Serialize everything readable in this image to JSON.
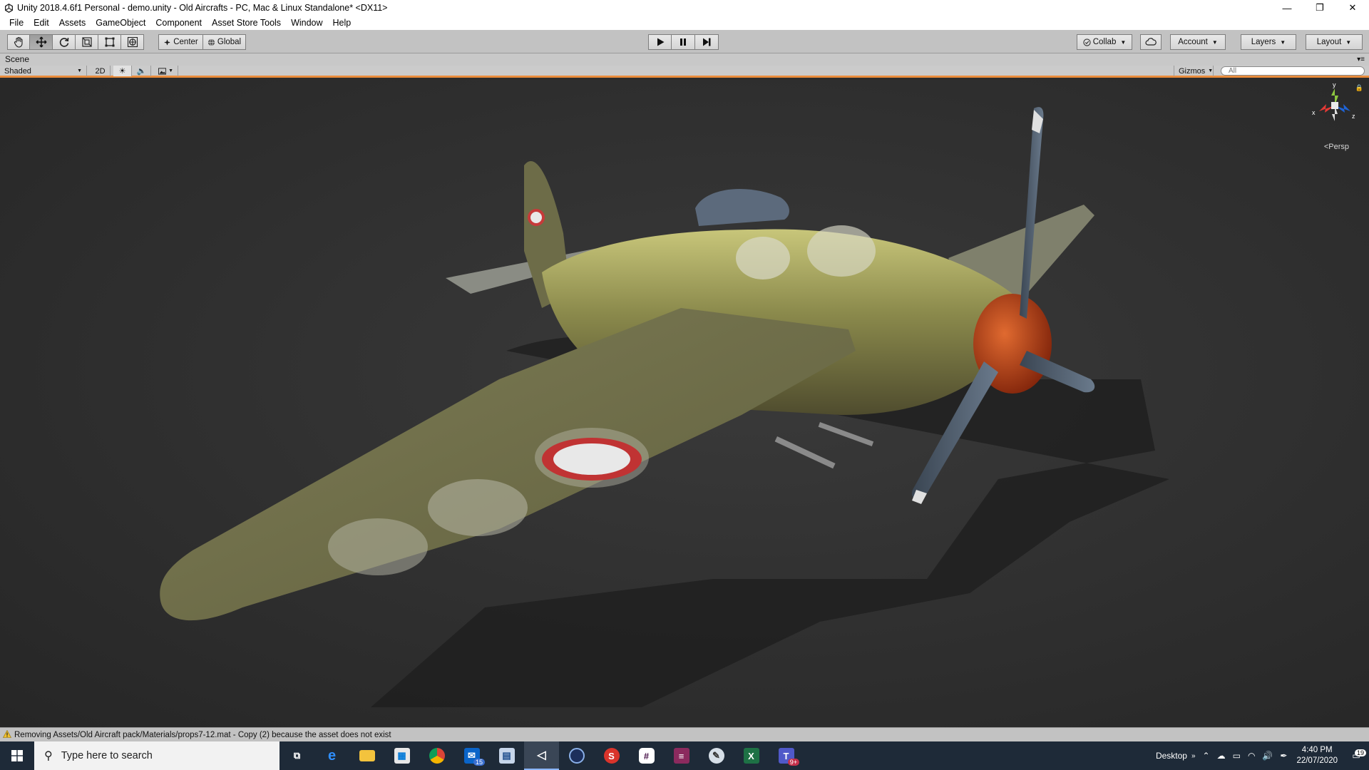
{
  "window": {
    "title": "Unity 2018.4.6f1 Personal - demo.unity - Old Aircrafts - PC, Mac & Linux Standalone* <DX11>",
    "minimize": "—",
    "maximize": "❐",
    "close": "✕"
  },
  "menu": [
    "File",
    "Edit",
    "Assets",
    "GameObject",
    "Component",
    "Asset Store Tools",
    "Window",
    "Help"
  ],
  "toolbar": {
    "pivot_mode": "Center",
    "pivot_rotation": "Global",
    "collab": "Collab",
    "account": "Account",
    "layers": "Layers",
    "layout": "Layout"
  },
  "scene": {
    "tab_label": "Scene",
    "draw_mode": "Shaded",
    "mode_2d": "2D",
    "gizmos": "Gizmos",
    "search_placeholder": "All",
    "persp_label": "Persp",
    "axis_y": "y",
    "axis_x": "x",
    "axis_z": "z"
  },
  "status": {
    "message": "Removing Assets/Old Aircraft pack/Materials/props7-12.mat - Copy (2) because the asset does not exist"
  },
  "taskbar": {
    "search_placeholder": "Type here to search",
    "mail_badge": "15",
    "teams_badge": "9+",
    "desktop_label": "Desktop",
    "time": "4:40 PM",
    "date": "22/07/2020",
    "notifications": "19"
  },
  "colors": {
    "scene_accent": "#e98c3c",
    "taskbar": "#1e2a38",
    "toolbar": "#c2c2c2"
  }
}
